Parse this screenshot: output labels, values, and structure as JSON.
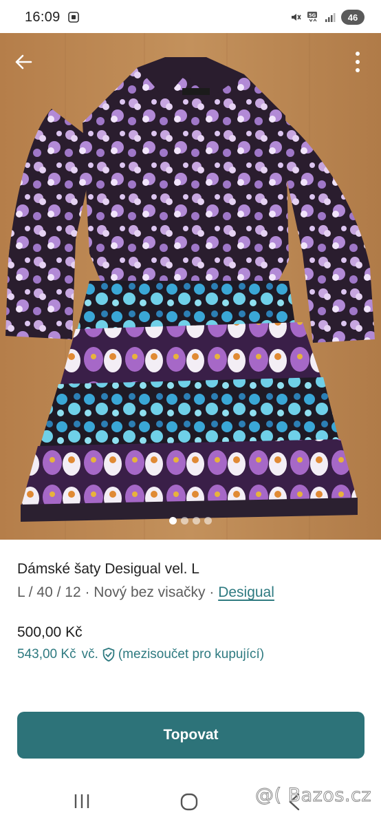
{
  "status_bar": {
    "time": "16:09",
    "network_label": "5G",
    "battery": "46"
  },
  "gallery": {
    "image_count": 4,
    "active_index": 0
  },
  "listing": {
    "title": "Dámské šaty Desigual vel. L",
    "meta_prefix": "L / 40 / 12 · Nový bez visačky ·",
    "brand": "Desigual",
    "price": "500,00 Kč",
    "buyer_price": "543,00 Kč",
    "buyer_price_suffix": "vč.",
    "buyer_price_note": "(mezisoučet pro kupující)"
  },
  "actions": {
    "primary_label": "Topovat"
  },
  "watermark": "@( Bazos.cz",
  "colors": {
    "accent": "#2d7379",
    "link": "#2e7a80"
  }
}
